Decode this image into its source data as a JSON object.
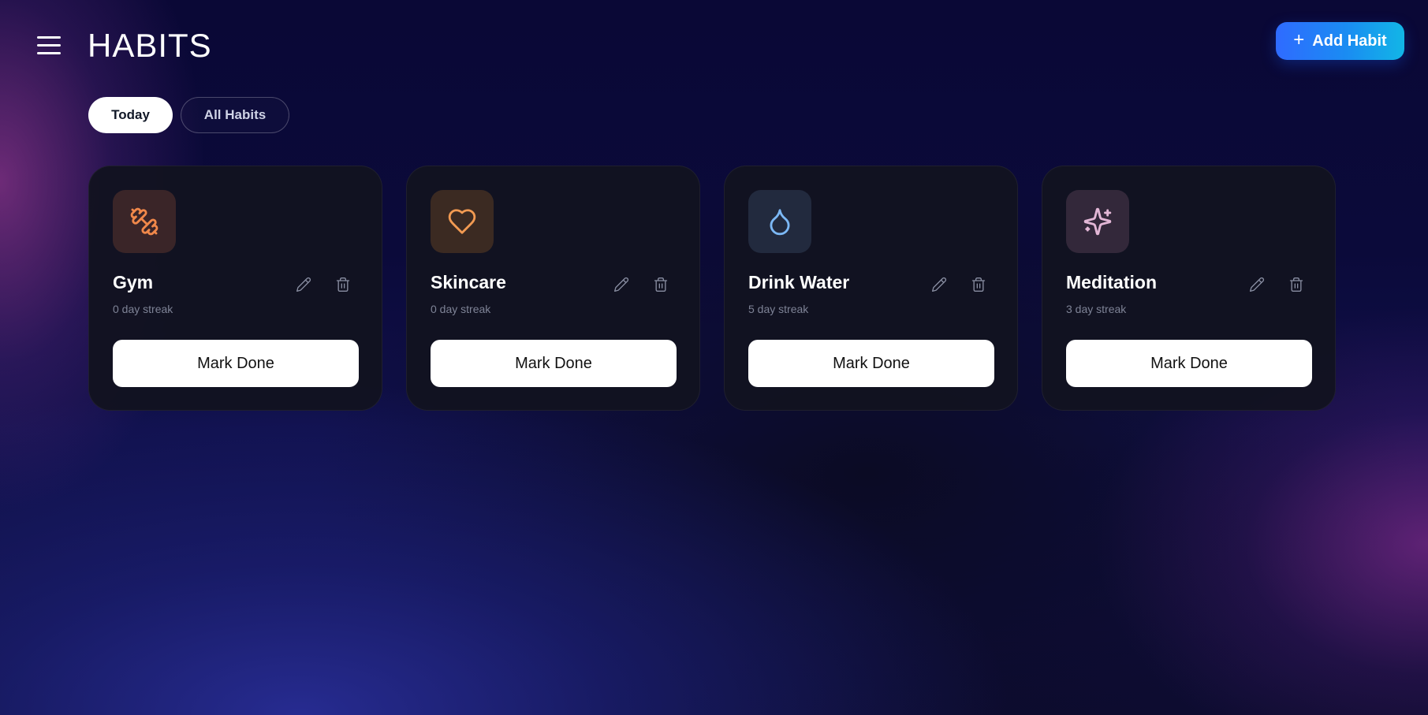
{
  "header": {
    "title": "HABITS",
    "add_button_label": "Add Habit",
    "add_button_icon": "plus-icon"
  },
  "tabs": [
    {
      "label": "Today",
      "active": true
    },
    {
      "label": "All Habits",
      "active": false
    }
  ],
  "habits": [
    {
      "name": "Gym",
      "streak": "0 day streak",
      "icon": "dumbbell-icon",
      "icon_color": "#f0884a",
      "icon_bg": "#3a2528",
      "action_label": "Mark Done"
    },
    {
      "name": "Skincare",
      "streak": "0 day streak",
      "icon": "heart-icon",
      "icon_color": "#f29a52",
      "icon_bg": "#3b2a22",
      "action_label": "Mark Done"
    },
    {
      "name": "Drink Water",
      "streak": "5 day streak",
      "icon": "water-drop-icon",
      "icon_color": "#7cb8f5",
      "icon_bg": "#222a3e",
      "action_label": "Mark Done"
    },
    {
      "name": "Meditation",
      "streak": "3 day streak",
      "icon": "sparkles-icon",
      "icon_color": "#e3b7d6",
      "icon_bg": "#33283a",
      "action_label": "Mark Done"
    }
  ],
  "colors": {
    "accent_gradient_start": "#2f6bff",
    "accent_gradient_end": "#12b6e6",
    "card_background": "#121320",
    "muted_text": "#7e8396"
  }
}
